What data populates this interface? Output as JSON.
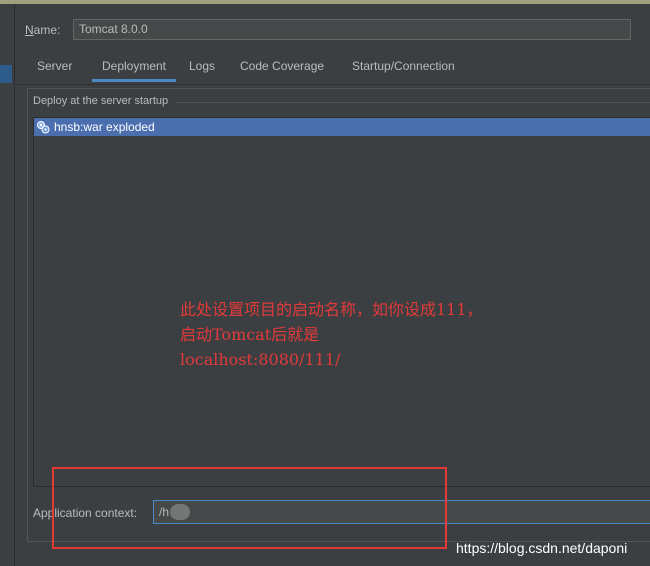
{
  "name_field": {
    "label": "Name:",
    "mnemonic": "N",
    "label_rest": "ame:",
    "value": "Tomcat 8.0.0"
  },
  "tabs": [
    {
      "label": "Server",
      "active": false
    },
    {
      "label": "Deployment",
      "active": true
    },
    {
      "label": "Logs",
      "active": false
    },
    {
      "label": "Code Coverage",
      "active": false
    },
    {
      "label": "Startup/Connection",
      "active": false
    }
  ],
  "deploy": {
    "title": "Deploy at the server startup",
    "items": [
      {
        "label": "hnsb:war exploded",
        "icon": "artifact-icon",
        "selected": true
      }
    ]
  },
  "annotation": {
    "lines": [
      "此处设置项目的启动名称，如你设成111，",
      "启动Tomcat后就是",
      "localhost:8080/111/"
    ],
    "color": "#e23a3a"
  },
  "app_context": {
    "label": "Application context:",
    "value": "/h"
  },
  "highlight_box_color": "#e53935",
  "watermark": "https://blog.csdn.net/daponi",
  "colors": {
    "background": "#3c3f41",
    "selection": "#4b6eaf",
    "tab_underline": "#4a88c7"
  }
}
